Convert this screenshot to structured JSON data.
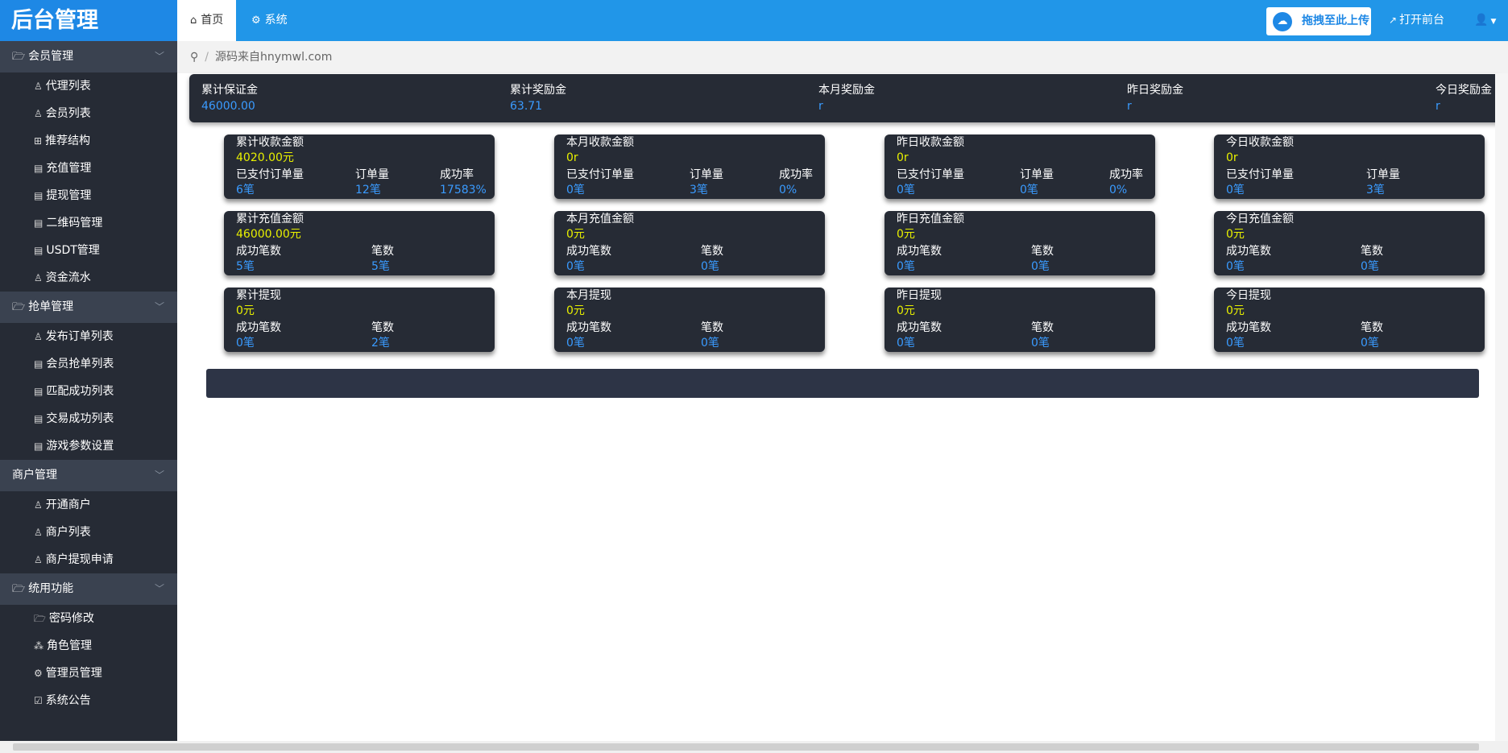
{
  "app": {
    "title": "后台管理"
  },
  "top_tabs": [
    {
      "label": "首页",
      "icon": "home-icon"
    },
    {
      "label": "系统",
      "icon": "gear-icon"
    }
  ],
  "upload_button": {
    "label": "拖拽至此上传",
    "icon": "cloud-icon"
  },
  "open_front": {
    "label": "打开前台",
    "icon": "external-link-icon"
  },
  "user_menu": {
    "icon": "user-icon"
  },
  "sidebar": {
    "groups": [
      {
        "label": "会员管理",
        "icon": "folder-open-icon",
        "items": [
          {
            "label": "代理列表",
            "icon": "user-icon"
          },
          {
            "label": "会员列表",
            "icon": "user-icon"
          },
          {
            "label": "推荐结构",
            "icon": "grid-icon"
          },
          {
            "label": "充值管理",
            "icon": "file-icon"
          },
          {
            "label": "提现管理",
            "icon": "file-icon"
          },
          {
            "label": "二维码管理",
            "icon": "file-icon"
          },
          {
            "label": "USDT管理",
            "icon": "file-icon"
          },
          {
            "label": "资金流水",
            "icon": "user-icon"
          }
        ]
      },
      {
        "label": "抢单管理",
        "icon": "folder-open-icon",
        "items": [
          {
            "label": "发布订单列表",
            "icon": "user-icon"
          },
          {
            "label": "会员抢单列表",
            "icon": "file-icon"
          },
          {
            "label": "匹配成功列表",
            "icon": "file-icon"
          },
          {
            "label": "交易成功列表",
            "icon": "file-icon"
          },
          {
            "label": "游戏参数设置",
            "icon": "file-icon"
          }
        ]
      },
      {
        "label": "商户管理",
        "icon": "",
        "items": [
          {
            "label": "开通商户",
            "icon": "user-icon"
          },
          {
            "label": "商户列表",
            "icon": "user-icon"
          },
          {
            "label": "商户提现申请",
            "icon": "user-icon"
          }
        ]
      },
      {
        "label": "统用功能",
        "icon": "folder-open-icon",
        "items": [
          {
            "label": "密码修改",
            "icon": "folder-open-icon"
          },
          {
            "label": "角色管理",
            "icon": "sitemap-icon"
          },
          {
            "label": "管理员管理",
            "icon": "gear-icon"
          },
          {
            "label": "系统公告",
            "icon": "edit-icon"
          }
        ]
      }
    ]
  },
  "breadcrumb": {
    "text": "源码来自hnymwl.com",
    "icon": "location-icon"
  },
  "summary": [
    {
      "label": "累计保证金",
      "value": "46000.00"
    },
    {
      "label": "累计奖励金",
      "value": "63.71"
    },
    {
      "label": "本月奖励金",
      "value": "r"
    },
    {
      "label": "昨日奖励金",
      "value": "r"
    },
    {
      "label": "今日奖励金",
      "value": "r"
    }
  ],
  "cards": [
    [
      {
        "title": "累计收款金额",
        "big": "4020.00元",
        "stats": [
          {
            "label": "已支付订单量",
            "value": "6笔"
          },
          {
            "label": "订单量",
            "value": "12笔"
          },
          {
            "label": "成功率",
            "value": "17583%"
          }
        ]
      },
      {
        "title": "本月收款金额",
        "big": "0r",
        "stats": [
          {
            "label": "已支付订单量",
            "value": "0笔"
          },
          {
            "label": "订单量",
            "value": "3笔"
          },
          {
            "label": "成功率",
            "value": "0%"
          }
        ]
      },
      {
        "title": "昨日收款金额",
        "big": "0r",
        "stats": [
          {
            "label": "已支付订单量",
            "value": "0笔"
          },
          {
            "label": "订单量",
            "value": "0笔"
          },
          {
            "label": "成功率",
            "value": "0%"
          }
        ]
      },
      {
        "title": "今日收款金额",
        "big": "0r",
        "stats": [
          {
            "label": "已支付订单量",
            "value": "0笔"
          },
          {
            "label": "订单量",
            "value": "3笔"
          }
        ]
      }
    ],
    [
      {
        "title": "累计充值金额",
        "big": "46000.00元",
        "stats": [
          {
            "label": "成功笔数",
            "value": "5笔"
          },
          {
            "label": "笔数",
            "value": "5笔"
          }
        ]
      },
      {
        "title": "本月充值金额",
        "big": "0元",
        "stats": [
          {
            "label": "成功笔数",
            "value": "0笔"
          },
          {
            "label": "笔数",
            "value": "0笔"
          }
        ]
      },
      {
        "title": "昨日充值金额",
        "big": "0元",
        "stats": [
          {
            "label": "成功笔数",
            "value": "0笔"
          },
          {
            "label": "笔数",
            "value": "0笔"
          }
        ]
      },
      {
        "title": "今日充值金额",
        "big": "0元",
        "stats": [
          {
            "label": "成功笔数",
            "value": "0笔"
          },
          {
            "label": "笔数",
            "value": "0笔"
          }
        ]
      }
    ],
    [
      {
        "title": "累计提现",
        "big": "0元",
        "stats": [
          {
            "label": "成功笔数",
            "value": "0笔"
          },
          {
            "label": "笔数",
            "value": "2笔"
          }
        ]
      },
      {
        "title": "本月提现",
        "big": "0元",
        "stats": [
          {
            "label": "成功笔数",
            "value": "0笔"
          },
          {
            "label": "笔数",
            "value": "0笔"
          }
        ]
      },
      {
        "title": "昨日提现",
        "big": "0元",
        "stats": [
          {
            "label": "成功笔数",
            "value": "0笔"
          },
          {
            "label": "笔数",
            "value": "0笔"
          }
        ]
      },
      {
        "title": "今日提现",
        "big": "0元",
        "stats": [
          {
            "label": "成功笔数",
            "value": "0笔"
          },
          {
            "label": "笔数",
            "value": "0笔"
          }
        ]
      }
    ]
  ],
  "colors": {
    "header": "#2196e8",
    "sidebar": "#262b35",
    "card": "#262b35",
    "value_blue": "#3a9bff",
    "value_yellow": "#e8f000"
  }
}
